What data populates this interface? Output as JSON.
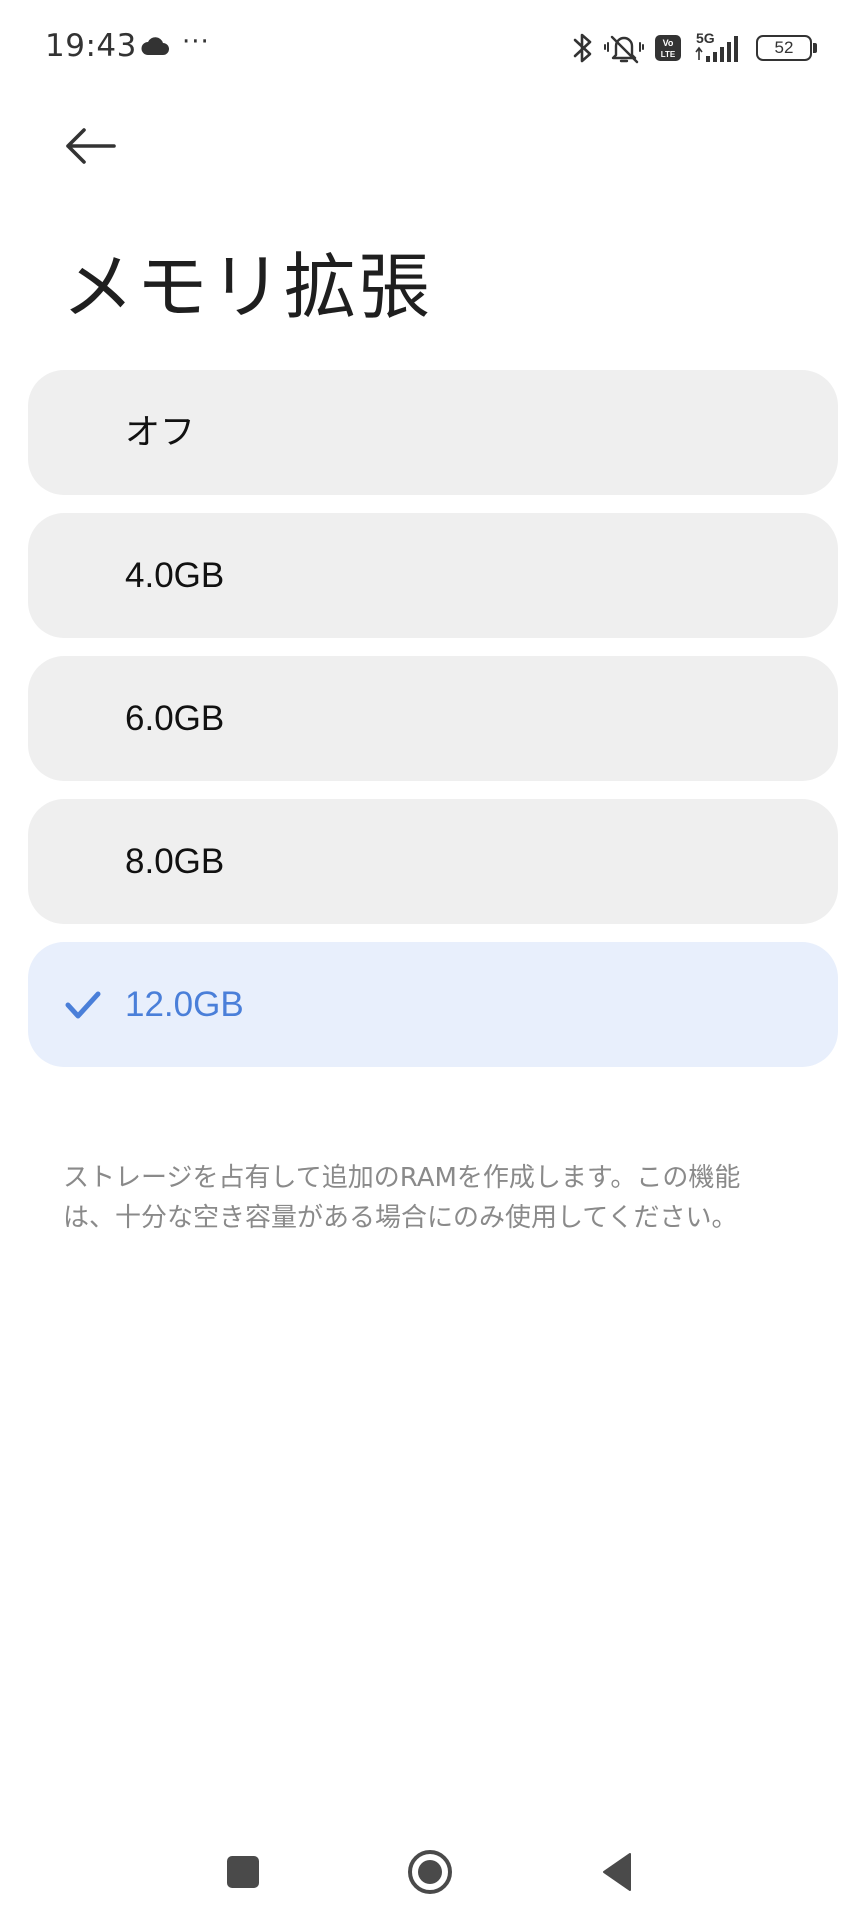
{
  "status_bar": {
    "time": "19:43",
    "more": "···",
    "battery_level": "52",
    "network": "5G",
    "volte": "Vo LTE"
  },
  "page": {
    "title": "メモリ拡張"
  },
  "options": [
    {
      "label": "オフ",
      "selected": false
    },
    {
      "label": "4.0GB",
      "selected": false
    },
    {
      "label": "6.0GB",
      "selected": false
    },
    {
      "label": "8.0GB",
      "selected": false
    },
    {
      "label": "12.0GB",
      "selected": true
    }
  ],
  "description": "ストレージを占有して追加のRAMを作成します。この機能は、十分な空き容量がある場合にのみ使用してください。",
  "colors": {
    "accent": "#4a7fd9",
    "option_bg": "#efefef",
    "selected_bg": "#e8effc"
  },
  "icons": {
    "back": "arrow-left-icon",
    "check": "check-icon",
    "status": [
      "cloud-icon",
      "bluetooth-icon",
      "notifications-off-icon",
      "volte-icon",
      "signal-icon",
      "battery-icon"
    ],
    "nav": [
      "recents-icon",
      "home-icon",
      "back-triangle-icon"
    ]
  }
}
